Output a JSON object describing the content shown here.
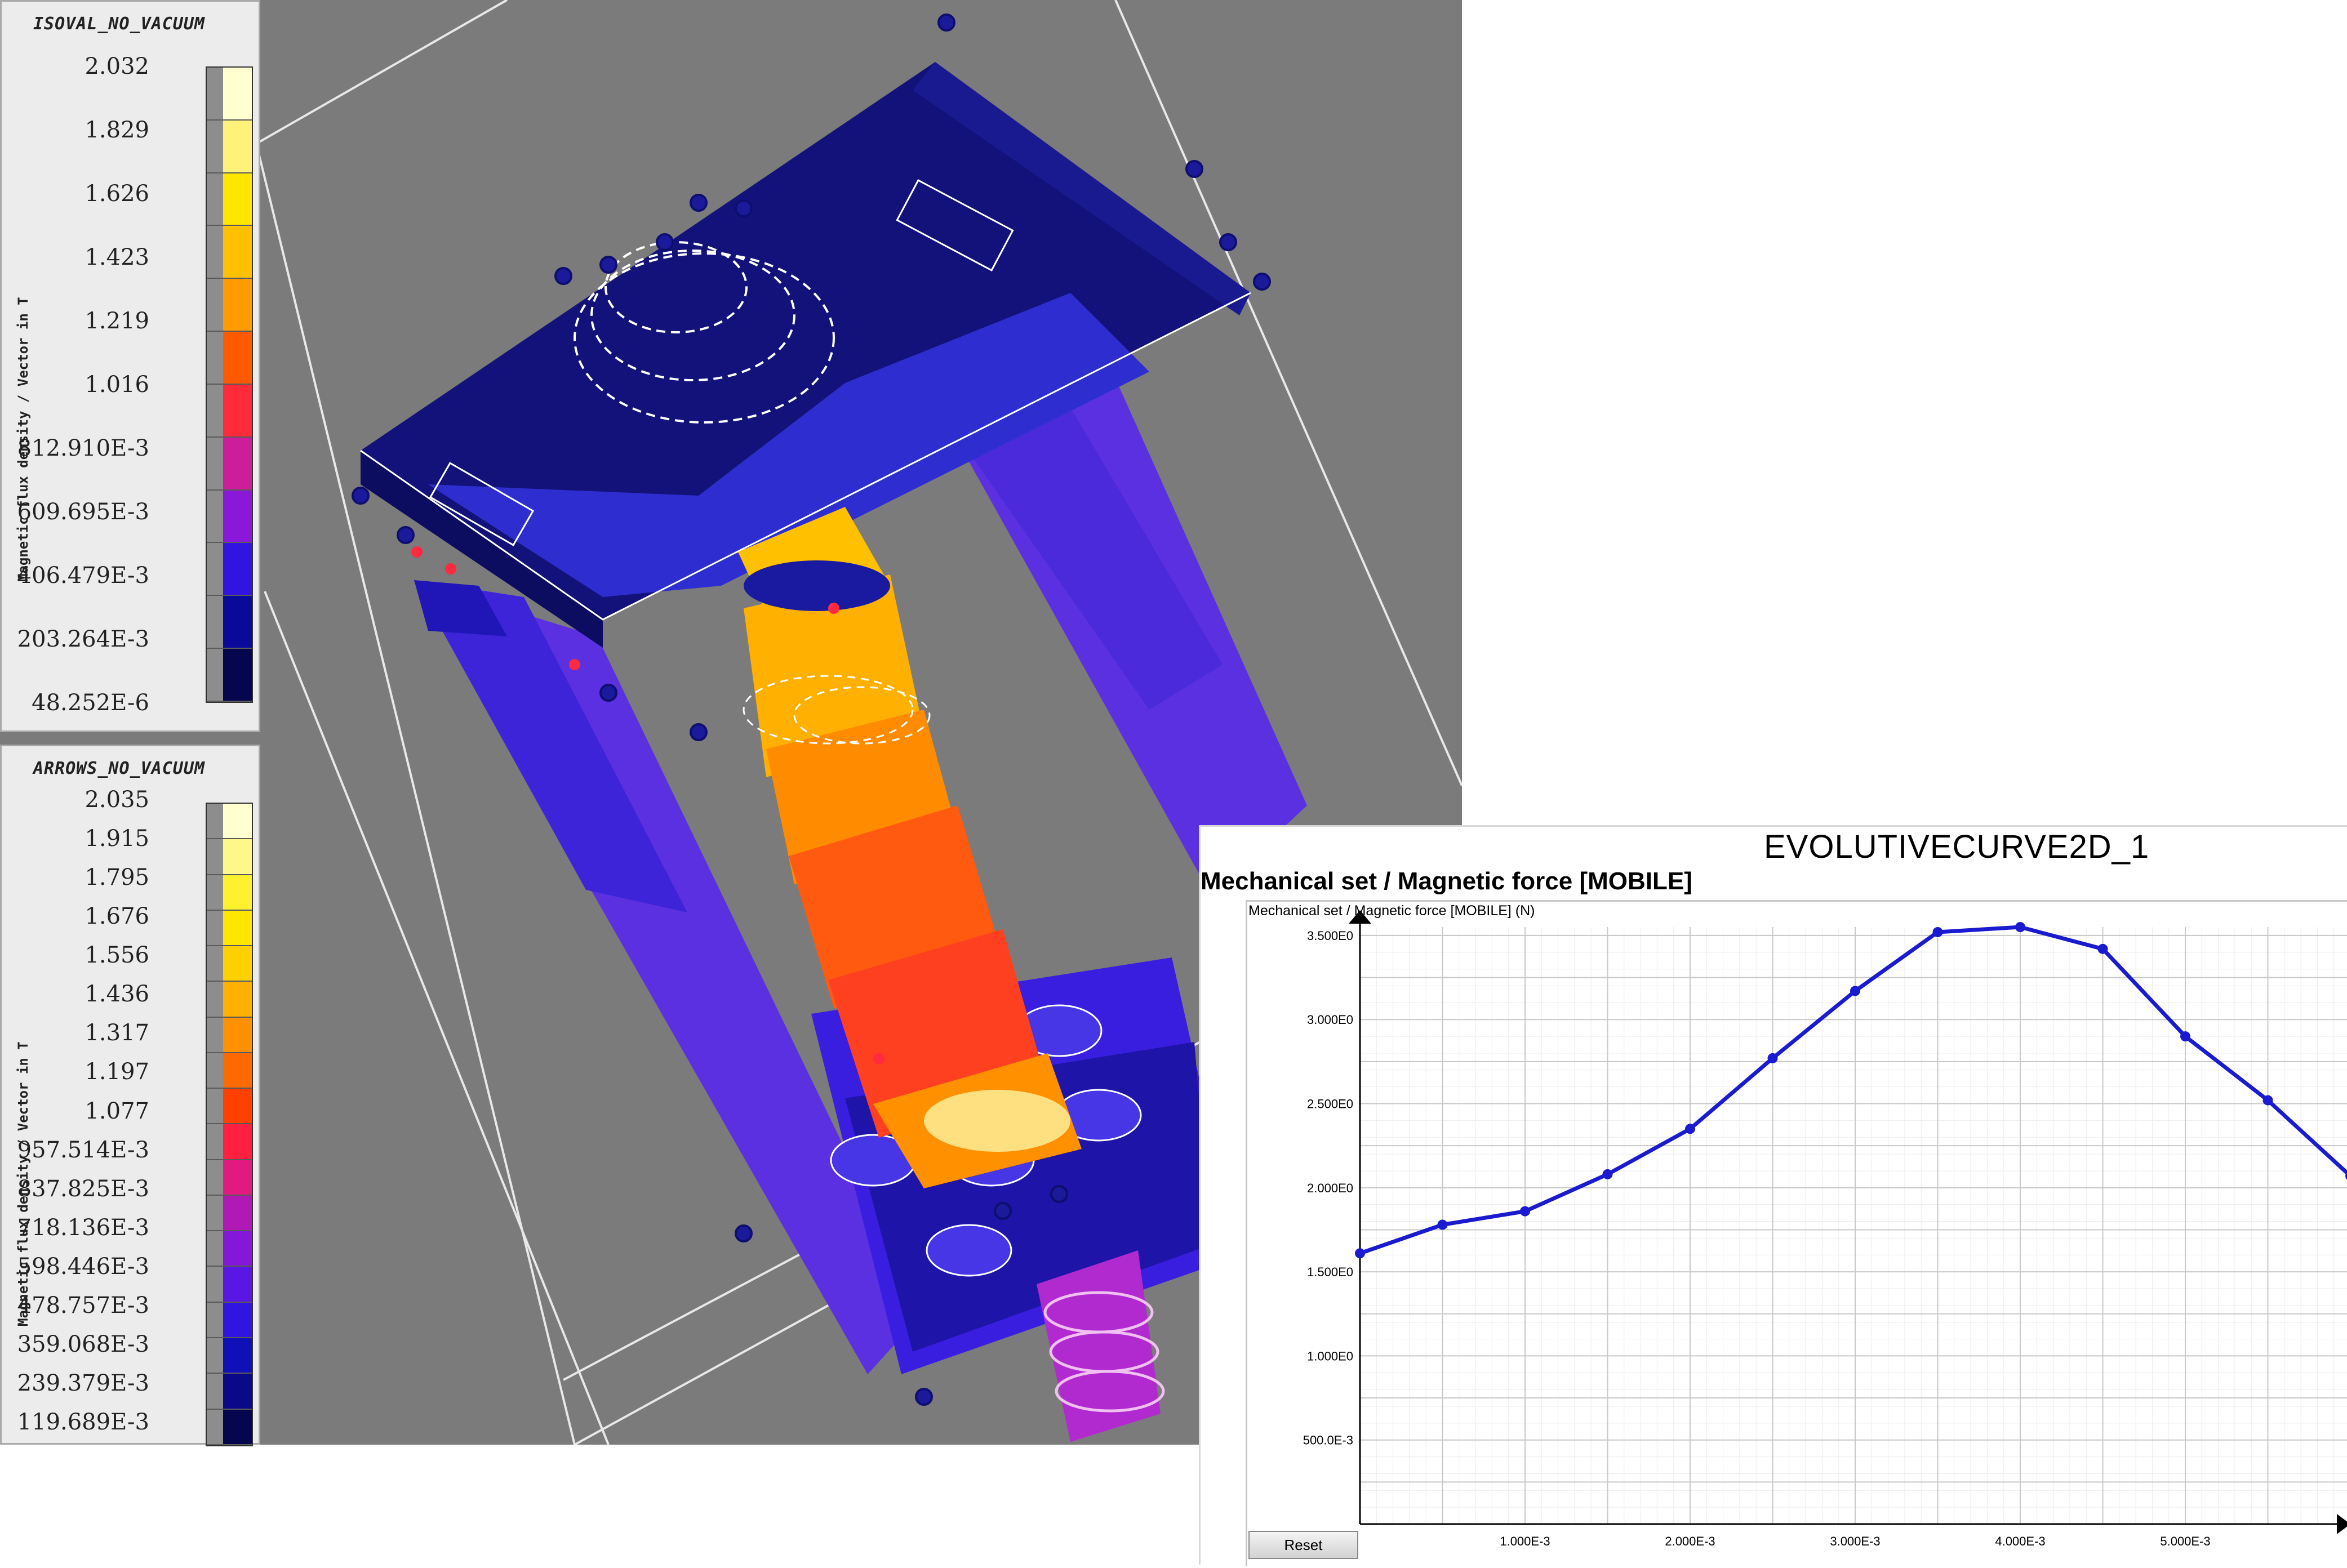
{
  "viewport": {
    "background": "#7b7b7b"
  },
  "legend_iso": {
    "title": "ISOVAL_NO_VACUUM",
    "axis_label": "Magnetic flux density / Vector in T",
    "values": [
      "2.032",
      "1.829",
      "1.626",
      "1.423",
      "1.219",
      "1.016",
      "812.910E-3",
      "609.695E-3",
      "406.479E-3",
      "203.264E-3",
      "48.252E-6"
    ],
    "colors": [
      "#ffffd0",
      "#fff27a",
      "#ffe600",
      "#ffc000",
      "#ff9a00",
      "#ff5a00",
      "#ff2a3a",
      "#cc1d9a",
      "#8a18d8",
      "#3214e0",
      "#0a0a9a",
      "#06064e"
    ]
  },
  "legend_arrows": {
    "title": "ARROWS_NO_VACUUM",
    "axis_label": "Magnetic flux density / Vector in T",
    "values": [
      "2.035",
      "1.915",
      "1.795",
      "1.676",
      "1.556",
      "1.436",
      "1.317",
      "1.197",
      "1.077",
      "957.514E-3",
      "837.825E-3",
      "718.136E-3",
      "598.446E-3",
      "478.757E-3",
      "359.068E-3",
      "239.379E-3",
      "119.689E-3"
    ],
    "colors": [
      "#ffffd0",
      "#fff78a",
      "#fff030",
      "#ffe600",
      "#ffd000",
      "#ffb000",
      "#ff9000",
      "#ff6a00",
      "#ff4000",
      "#ff2040",
      "#e01a80",
      "#b01ab4",
      "#8418d8",
      "#5a16e2",
      "#3014e0",
      "#1010b8",
      "#0a0a88",
      "#06064e"
    ]
  },
  "chart": {
    "title": "EVOLUTIVECURVE2D_1",
    "subtitle": "Mechanical set / Magnetic force [MOBILE]",
    "axis_title": "Mechanical set / Magnetic force [MOBILE] (N)",
    "reset_label": "Reset",
    "line_color": "#1a1ad0",
    "grid_color": "#c8c8c8",
    "y_tick_labels": [
      "500.0E-3",
      "1.000E0",
      "1.500E0",
      "2.000E0",
      "2.500E0",
      "3.000E0",
      "3.500E0"
    ],
    "x_tick_labels": [
      "1.000E-3",
      "2.000E-3",
      "3.000E-3",
      "4.000E-3",
      "5.000E-3"
    ]
  },
  "chart_data": {
    "type": "line",
    "title": "EVOLUTIVECURVE2D_1",
    "ylabel": "Mechanical set / Magnetic force [MOBILE] (N)",
    "xlabel": "",
    "xlim": [
      0,
      0.006
    ],
    "ylim": [
      0,
      3.55
    ],
    "grid": true,
    "x": [
      0,
      0.0005,
      0.001,
      0.0015,
      0.002,
      0.0025,
      0.003,
      0.0035,
      0.004,
      0.0045,
      0.005,
      0.0055,
      0.006
    ],
    "values": [
      1.61,
      1.78,
      1.86,
      2.08,
      2.35,
      2.77,
      3.17,
      3.52,
      3.55,
      3.42,
      2.9,
      2.52,
      2.07
    ]
  }
}
